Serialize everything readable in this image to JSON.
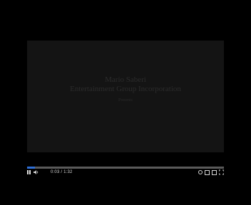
{
  "video": {
    "title_line1": "Mario Saberi",
    "title_line2": "Entertainment Group Incorporation",
    "title_line3": "Presents"
  },
  "player": {
    "progress_fraction": 0.04,
    "accent_color": "#2f6fd6",
    "time_readout": "0:03 / 1:32",
    "controls": {
      "play_pause_icon": "pause-icon",
      "volume_icon": "volume-icon",
      "settings_icon": "gear-icon",
      "captions_icon": "captions-icon",
      "miniplayer_icon": "miniplayer-icon",
      "fullscreen_icon": "fullscreen-icon"
    }
  }
}
